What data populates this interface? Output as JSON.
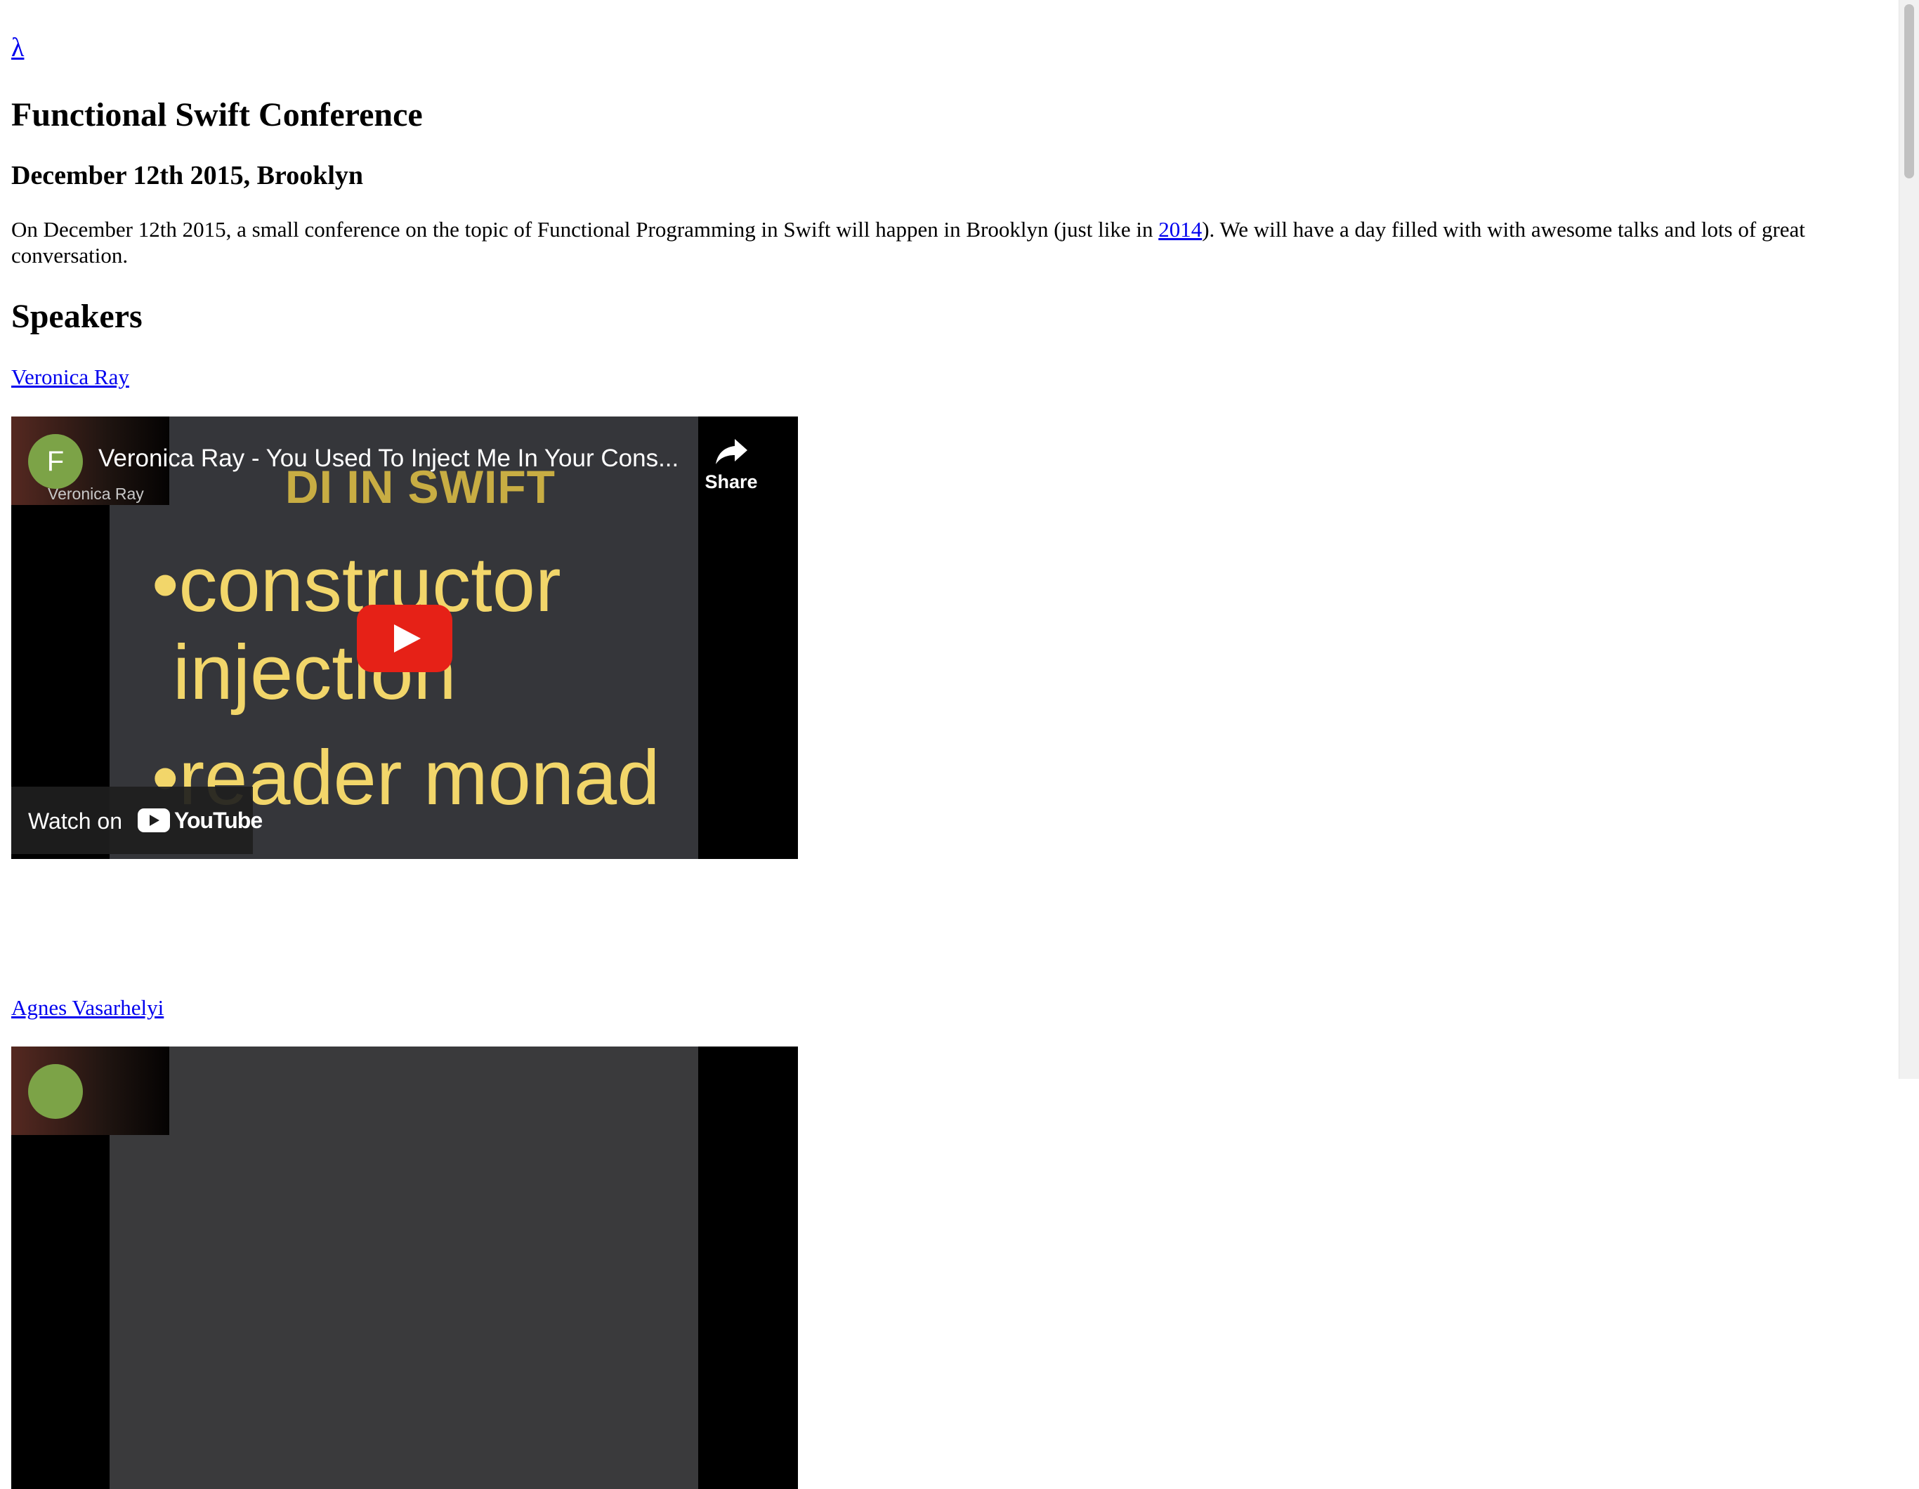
{
  "header": {
    "logo": "λ",
    "title": "Functional Swift Conference",
    "subtitle": "December 12th 2015, Brooklyn"
  },
  "intro": {
    "before_link": "On December 12th 2015, a small conference on the topic of Functional Programming in Swift will happen in Brooklyn (just like in ",
    "link_text": "2014",
    "after_link": "). We will have a day filled with with awesome talks and lots of great conversation."
  },
  "speakers_heading": "Speakers",
  "speakers": [
    {
      "name": "Veronica Ray",
      "video": {
        "channel_initial": "F",
        "title": "Veronica Ray - You Used To Inject Me In Your Cons...",
        "thumb_name": "Veronica Ray",
        "slide_heading": "DI IN SWIFT",
        "bullets": [
          "•constructor",
          "injection",
          "•reader monad"
        ],
        "share_label": "Share",
        "watch_on_label": "Watch on",
        "youtube_label": "YouTube"
      }
    },
    {
      "name": "Agnes Vasarhelyi"
    }
  ]
}
